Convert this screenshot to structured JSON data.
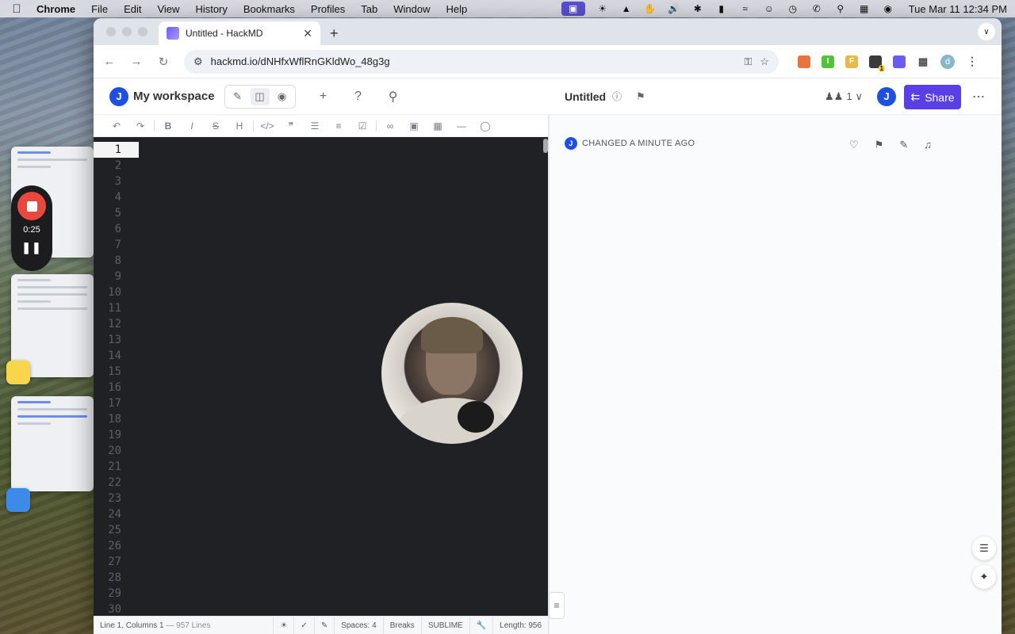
{
  "menubar": {
    "app_name": "Chrome",
    "items": [
      "File",
      "Edit",
      "View",
      "History",
      "Bookmarks",
      "Profiles",
      "Tab",
      "Window",
      "Help"
    ],
    "clock": "Tue Mar 11  12:34 PM"
  },
  "recorder": {
    "time": "0:25"
  },
  "browser": {
    "tab_title": "Untitled - HackMD",
    "url": "hackmd.io/dNHfxWflRnGKldWo_48g3g",
    "profile_initial": "d",
    "ext_badge": "1"
  },
  "header": {
    "avatar_initial": "J",
    "workspace": "My workspace",
    "doc_title": "Untitled",
    "viewer_count": "1",
    "share_label": "Share"
  },
  "editor": {
    "line_numbers": [
      "1",
      "2",
      "3",
      "4",
      "5",
      "6",
      "7",
      "8",
      "9",
      "10",
      "11",
      "12",
      "13",
      "14",
      "15",
      "16",
      "17",
      "18",
      "19",
      "20",
      "21",
      "22",
      "23",
      "24",
      "25",
      "26",
      "27",
      "28",
      "29",
      "30"
    ],
    "status": {
      "position": "Line 1, Columns 1",
      "lines": "— 957 Lines",
      "spaces": "Spaces: 4",
      "breaks": "Breaks",
      "keymap": "SUBLIME",
      "length": "Length: 956"
    }
  },
  "preview": {
    "changed_label": "CHANGED A MINUTE AGO"
  },
  "colors": {
    "brand": "#5b3fe6",
    "avatar": "#1f4fe0",
    "editor_bg": "#202124",
    "record": "#e8483d"
  }
}
